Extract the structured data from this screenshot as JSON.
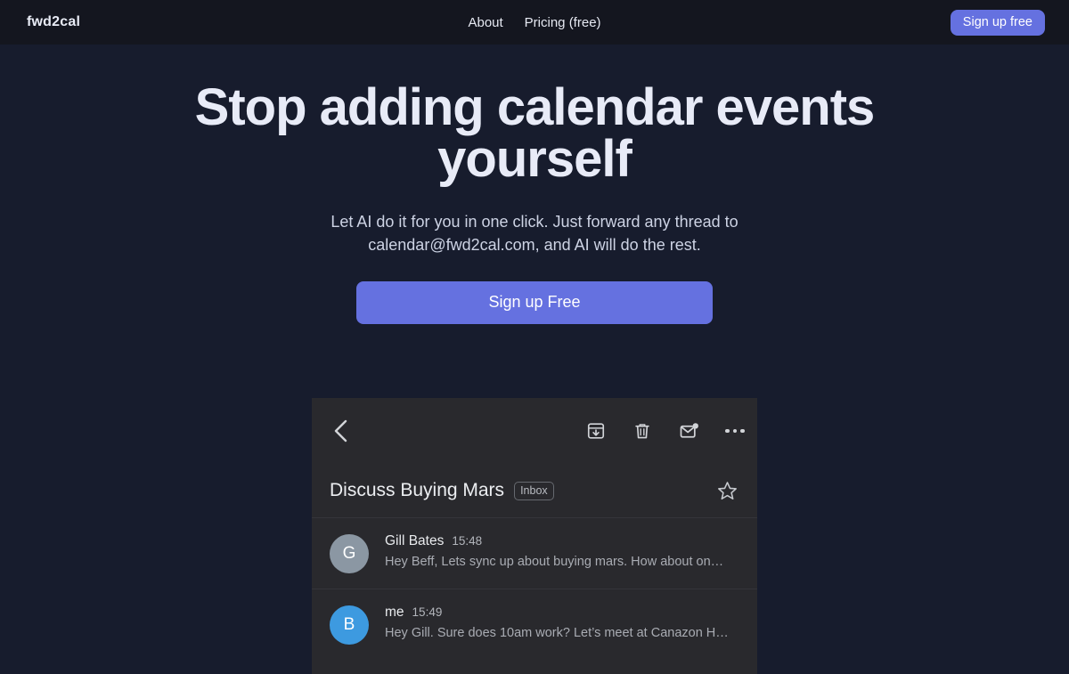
{
  "nav": {
    "brand": "fwd2cal",
    "links": [
      {
        "label": "About",
        "name": "nav-link-about"
      },
      {
        "label": "Pricing (free)",
        "name": "nav-link-pricing"
      }
    ],
    "cta_label": "Sign up free",
    "cta_color": "#6571e0"
  },
  "hero": {
    "title": "Stop adding calendar events yourself",
    "subtitle": "Let AI do it for you in one click. Just forward any thread to calendar@fwd2cal.com, and AI will do the rest.",
    "cta_label": "Sign up Free",
    "cta_color": "#6571e0"
  },
  "mail_mock": {
    "toolbar": {
      "back_icon": "back-arrow-icon",
      "actions": [
        {
          "icon": "archive-icon",
          "name": "archive-button"
        },
        {
          "icon": "trash-icon",
          "name": "delete-button"
        },
        {
          "icon": "mark-unread-icon",
          "name": "mark-unread-button"
        },
        {
          "icon": "more-options-icon",
          "name": "more-options-button"
        }
      ]
    },
    "subject": "Discuss Buying Mars",
    "label_badge": "Inbox",
    "star_icon": "star-outline-icon",
    "messages": [
      {
        "initial": "G",
        "avatar_color": "#8b97a3",
        "sender": "Gill Bates",
        "time": "15:48",
        "snippet": "Hey Beff, Lets sync up about buying mars. How about on…"
      },
      {
        "initial": "B",
        "avatar_color": "#3d9ae0",
        "sender": "me",
        "time": "15:49",
        "snippet": "Hey Gill. Sure does 10am work? Let’s meet at Canazon H…"
      }
    ]
  }
}
